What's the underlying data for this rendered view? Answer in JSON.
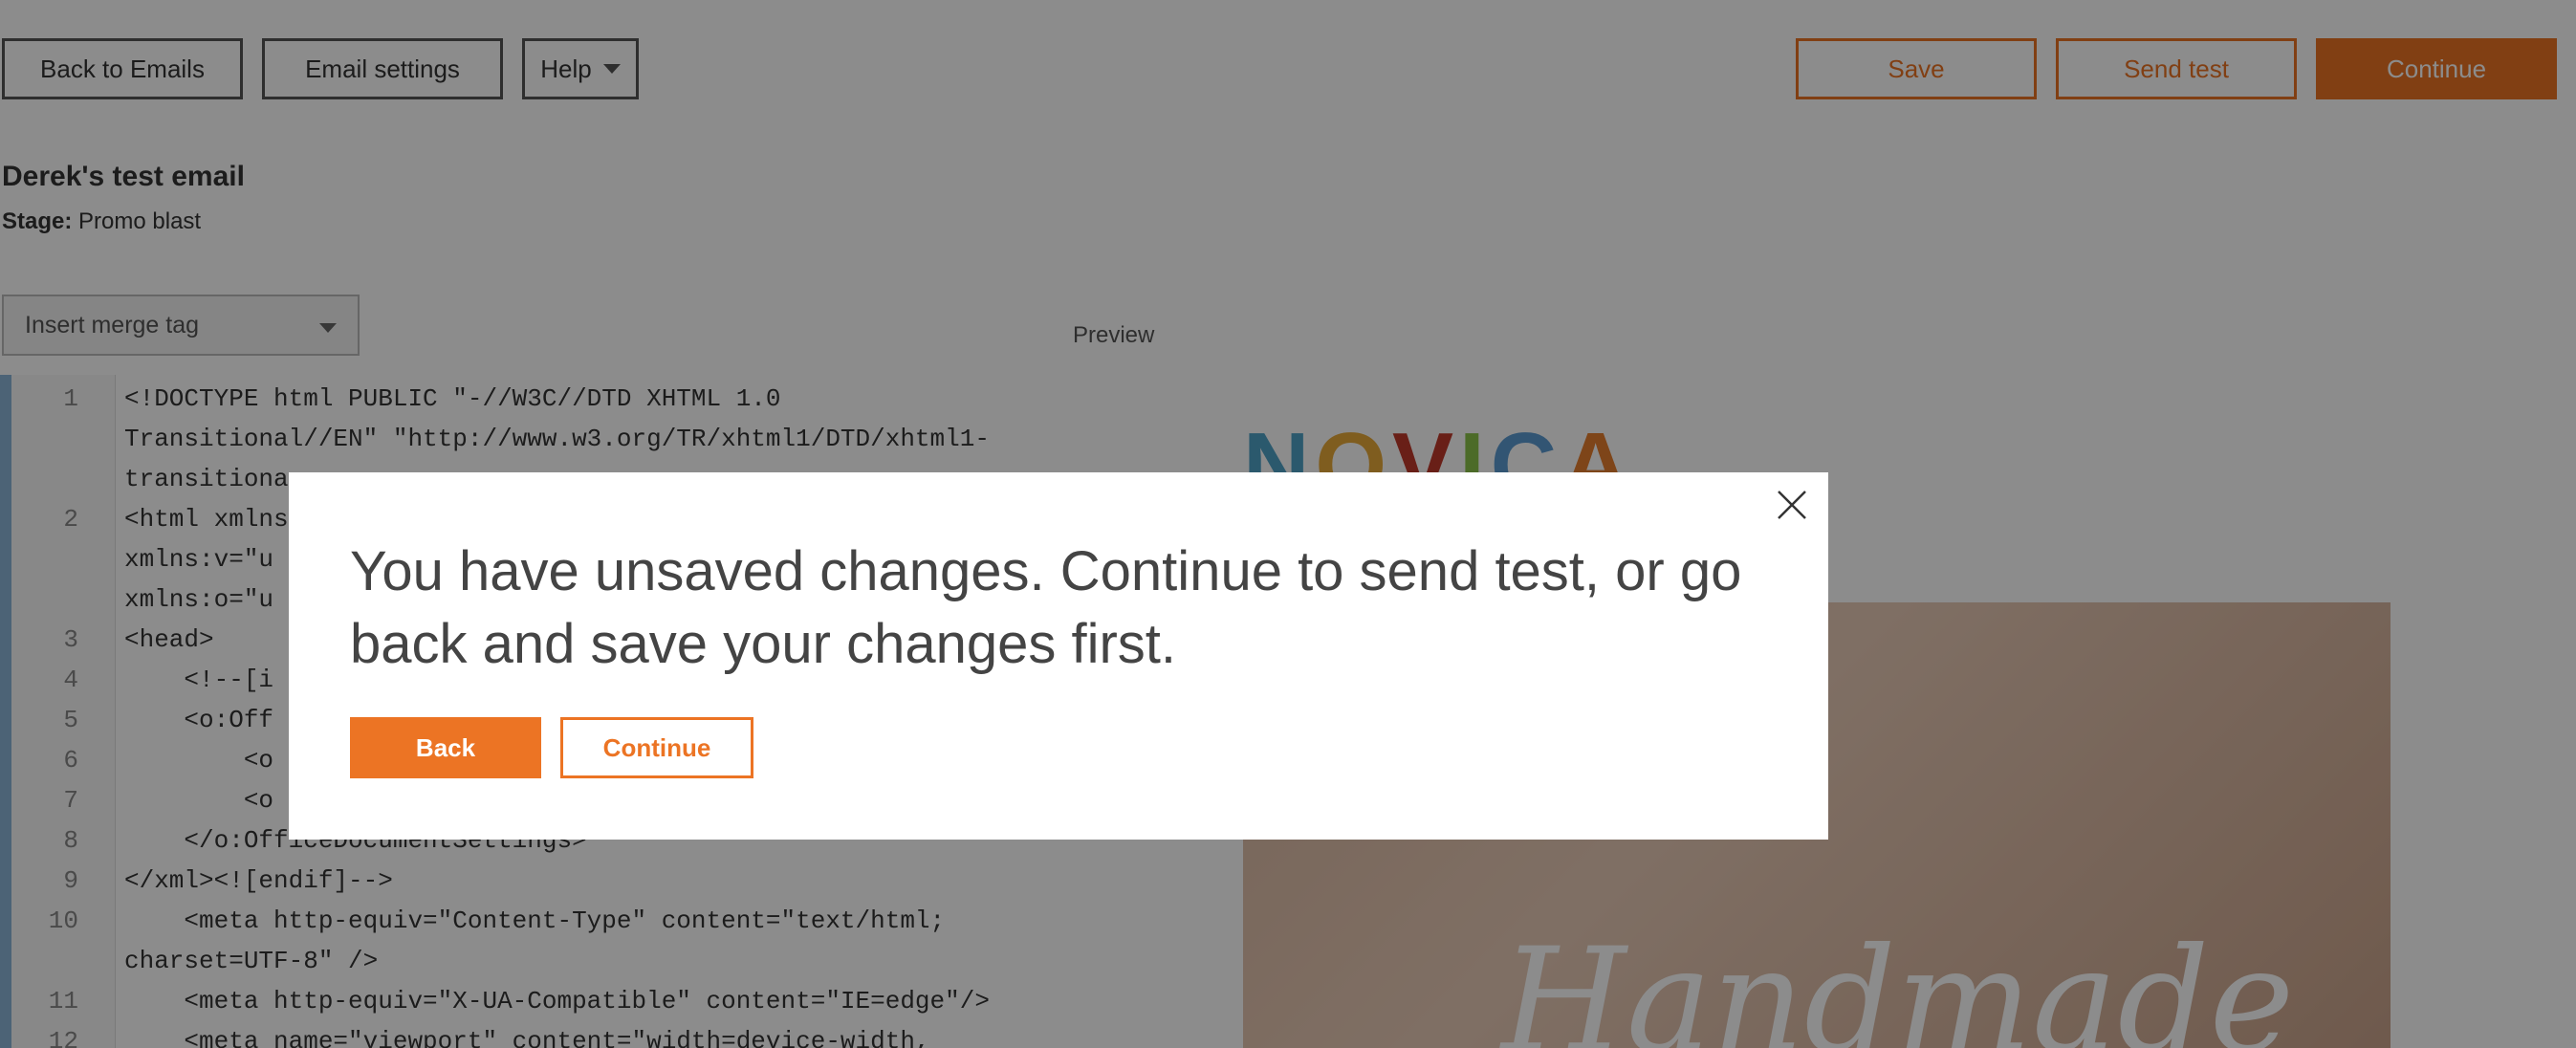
{
  "toolbar": {
    "back_label": "Back to Emails",
    "settings_label": "Email settings",
    "help_label": "Help",
    "save_label": "Save",
    "send_test_label": "Send test",
    "continue_label": "Continue"
  },
  "email": {
    "title": "Derek's test email",
    "stage_label": "Stage:",
    "stage_value": "Promo blast"
  },
  "merge_tag": {
    "label": "Insert merge tag"
  },
  "preview": {
    "label": "Preview",
    "logo_text": "NOVICA",
    "hero_text": "Handmade"
  },
  "code_lines": [
    {
      "num": "1",
      "text": "<!DOCTYPE html PUBLIC \"-//W3C//DTD XHTML 1.0"
    },
    {
      "num": "",
      "text": "Transitional//EN\" \"http://www.w3.org/TR/xhtml1/DTD/xhtml1-"
    },
    {
      "num": "",
      "text": "transitiona"
    },
    {
      "num": "2",
      "text": "<html xmlns"
    },
    {
      "num": "",
      "text": "xmlns:v=\"u"
    },
    {
      "num": "",
      "text": "xmlns:o=\"u"
    },
    {
      "num": "3",
      "text": "<head>"
    },
    {
      "num": "4",
      "text": "    <!--[i"
    },
    {
      "num": "5",
      "text": "    <o:Off"
    },
    {
      "num": "6",
      "text": "        <o"
    },
    {
      "num": "7",
      "text": "        <o"
    },
    {
      "num": "8",
      "text": "    </o:OfficeDocumentSettings>"
    },
    {
      "num": "9",
      "text": "</xml><![endif]-->"
    },
    {
      "num": "10",
      "text": "    <meta http-equiv=\"Content-Type\" content=\"text/html;"
    },
    {
      "num": "",
      "text": "charset=UTF-8\" />"
    },
    {
      "num": "11",
      "text": "    <meta http-equiv=\"X-UA-Compatible\" content=\"IE=edge\"/>"
    },
    {
      "num": "12",
      "text": "    <meta name=\"viewport\" content=\"width=device-width,"
    }
  ],
  "dialog": {
    "message": "You have unsaved changes. Continue to send test, or go back and save your changes first.",
    "back_label": "Back",
    "continue_label": "Continue",
    "close_icon": "close-icon"
  },
  "colors": {
    "accent": "#ec7424",
    "overlay": "rgba(0,0,0,0.45)"
  }
}
